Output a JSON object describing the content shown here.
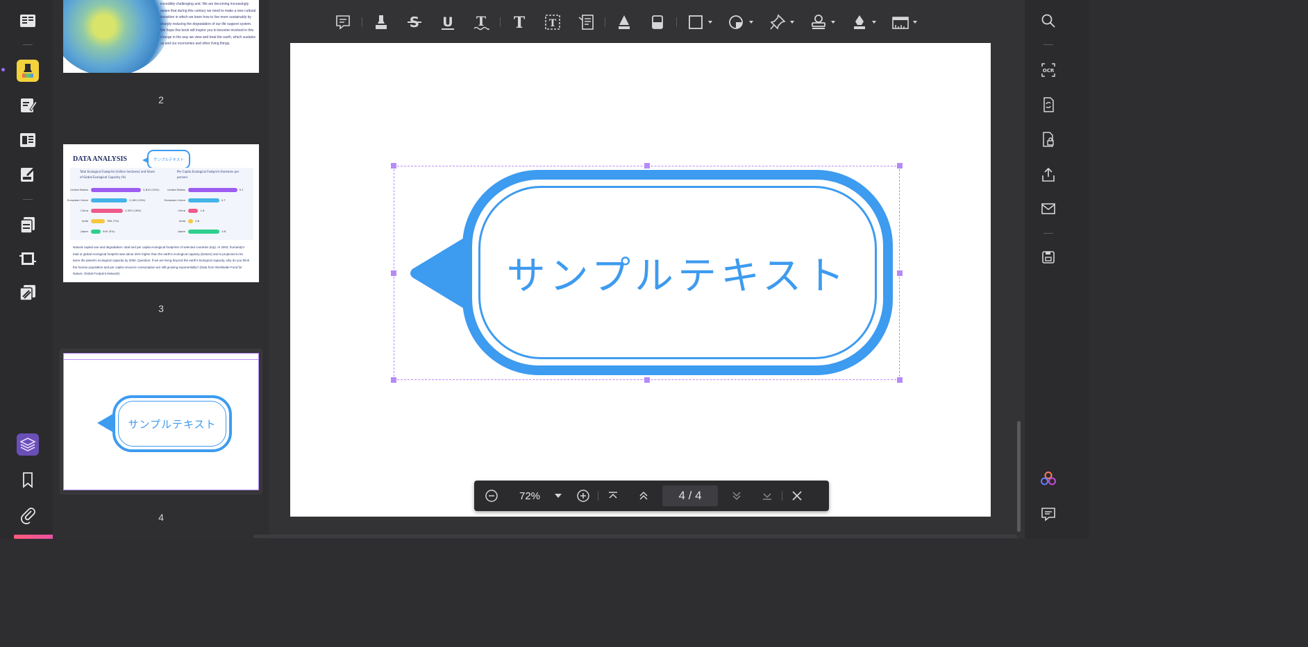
{
  "thumbnails": {
    "page2": {
      "number": "2",
      "text": "incredibly challenging and. We are becoming increasingly aware that during this century we need to make a new cultural transition in which we learn how to live more sustainably by sharply reducing the degradation of our life support system. We hope this book will inspire you to become involved in this change in the way we view and treat the earth, which sustains us and our economies and other living things."
    },
    "page3": {
      "number": "3",
      "title": "DATA ANALYSIS",
      "bubble_text": "サンプルテキスト",
      "col1_header": "Total Ecological Footprint (million hectares) and Share of Global Ecological Capacity (%)",
      "col2_header": "Per Capita Ecological Footprint (hectares per person)",
      "col1_rows": [
        {
          "label": "United States",
          "value": "2,810 (25%)",
          "color": "#9c5cf0",
          "frac": 0.72
        },
        {
          "label": "European Union",
          "value": "2,160 (19%)",
          "color": "#44b4e8",
          "frac": 0.52
        },
        {
          "label": "China",
          "value": "2,050 (18%)",
          "color": "#ef5a8a",
          "frac": 0.46
        },
        {
          "label": "India",
          "value": "780 (7%)",
          "color": "#f5c842",
          "frac": 0.2
        },
        {
          "label": "Japan",
          "value": "540 (5%)",
          "color": "#2fcf8c",
          "frac": 0.14
        }
      ],
      "col2_rows": [
        {
          "label": "United States",
          "value": "9.7",
          "color": "#9c5cf0",
          "frac": 0.98
        },
        {
          "label": "European Union",
          "value": "4.7",
          "color": "#44b4e8",
          "frac": 0.62
        },
        {
          "label": "China",
          "value": "1.6",
          "color": "#ef5a8a",
          "frac": 0.2
        },
        {
          "label": "India",
          "value": "0.8",
          "color": "#f5c842",
          "frac": 0.1
        },
        {
          "label": "Japan",
          "value": "4.8",
          "color": "#2fcf8c",
          "frac": 0.63
        }
      ],
      "paragraph": "Natural capital use and degradation: total and per capita ecological footprints of selected countries (top). In 2003, humanity's total or global ecological footprint was about 25% higher than the earth's ecological capacity (bottom) and is projected to be twice the planet's ecological capacity by 2050. Question: If we are living beyond the earth's biological capacity, why do you think the human population and per capita resource consumption are still growing exponentially? (Data from Worldwide Fund for Nature, Global Footprint Network)"
    },
    "page4": {
      "number": "4",
      "bubble_text": "サンプルテキスト"
    }
  },
  "document": {
    "bubble_text": "サンプルテキスト",
    "accent_color": "#3d9bf0",
    "selection_color": "#b68af7"
  },
  "zoombar": {
    "zoom": "72%",
    "page_indicator": "4 / 4"
  },
  "icons": {
    "left_rail": [
      "reader-icon",
      "highlight-icon",
      "edit-icon",
      "form-icon",
      "sign-icon",
      "organize-icon",
      "crop-icon",
      "watermark-icon",
      "layers-icon",
      "bookmark-icon",
      "attachment-icon"
    ],
    "toolbar": [
      "comment-icon",
      "highlighter-icon",
      "strikethrough-icon",
      "underline-icon",
      "squiggly-icon",
      "text-icon",
      "textbox-icon",
      "callout-icon",
      "pencil-icon",
      "eraser-icon",
      "rectangle-icon",
      "shape-icon",
      "pin-icon",
      "stamp-icon",
      "signature-icon",
      "measure-icon"
    ],
    "right_rail": [
      "search-icon",
      "ocr-icon",
      "convert-icon",
      "protect-icon",
      "share-icon",
      "mail-icon",
      "save-icon",
      "ai-icon",
      "comments-icon"
    ]
  }
}
